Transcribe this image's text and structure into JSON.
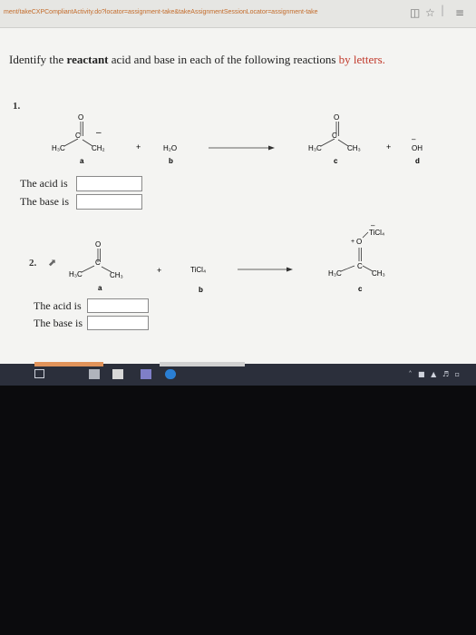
{
  "browser": {
    "url": "ment/takeCXPCompliantActivity.do?locator=assignment-take&takeAssignmentSessionLocator=assignment-take",
    "icons": [
      "reader-icon",
      "star-icon",
      "menu-icon"
    ]
  },
  "question": {
    "prefix": "Identify the ",
    "bold": "reactant",
    "middle": " acid and base in each of the following reactions ",
    "red": "by letters."
  },
  "reaction1": {
    "number": "1.",
    "molecules": {
      "a_left": "H₃C",
      "a_right": "CH₂",
      "b": "H₂O",
      "c_left": "H₃C",
      "c_right": "CH₃",
      "d": "OH"
    },
    "letters": [
      "a",
      "b",
      "c",
      "d"
    ],
    "acid_label": "The acid is",
    "base_label": "The base is",
    "acid_value": "",
    "base_value": ""
  },
  "reaction2": {
    "number": "2.",
    "molecules": {
      "a_left": "H₃C",
      "a_right": "CH₃",
      "b": "TiCl₄",
      "c_left": "H₃C",
      "c_right": "CH₃",
      "c_top": "TiCl₄"
    },
    "letters": [
      "a",
      "b",
      "c"
    ],
    "acid_label": "The acid is",
    "base_label": "The base is",
    "acid_value": "",
    "base_value": ""
  },
  "colors": {
    "accent_red": "#c0392b",
    "taskbar": "#2b2f3b",
    "url": "#c36b2a"
  }
}
